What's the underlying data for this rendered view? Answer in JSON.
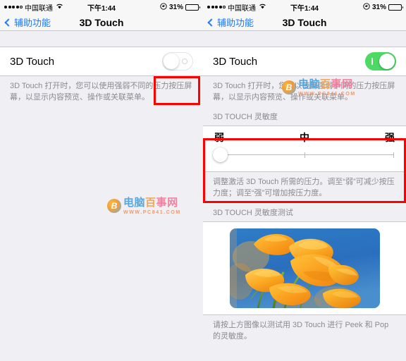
{
  "status_bar": {
    "carrier": "中国联通",
    "signal_dots": 5,
    "signal_filled": 4,
    "wifi_icon": "wifi-icon",
    "time": "下午1:44",
    "rotation_lock_icon": "rotation-lock-icon",
    "battery_percent": "31%",
    "battery_level": 31
  },
  "nav": {
    "back_label": "辅助功能",
    "back_icon": "chevron-left-icon",
    "title": "3D Touch"
  },
  "left_panel": {
    "row_label": "3D Touch",
    "toggle_state": "off",
    "footnote": "3D Touch 打开时，您可以使用强弱不同的压力按压屏幕，以显示内容预览、操作或关联菜单。"
  },
  "right_panel": {
    "row_label": "3D Touch",
    "toggle_state": "on",
    "footnote": "3D Touch 打开时，您可以使用强弱不同的压力按压屏幕，以显示内容预览、操作或关联菜单。",
    "sensitivity_header": "3D TOUCH 灵敏度",
    "slider": {
      "min_label": "弱",
      "mid_label": "中",
      "max_label": "强",
      "value": 0,
      "min": 0,
      "max": 2,
      "ticks": 3
    },
    "slider_footnote": "调整激活 3D Touch 所需的压力。调至“弱”可减少按压力度；调至“强”可增加按压力度。",
    "test_header": "3D TOUCH 灵敏度测试",
    "test_image_alt": "orange-poppy-flowers-photo",
    "test_footnote": "请按上方图像以测试用 3D Touch 进行 Peek 和 Pop 的灵敏度。"
  },
  "watermark": {
    "brand": "电脑百事网",
    "url": "WWW.PC841.COM",
    "logo_icon": "pc841-logo-icon"
  },
  "annotations": {
    "toggle_highlight": "red-box-toggle",
    "slider_highlight": "red-box-sensitivity"
  },
  "colors": {
    "toggle_on": "#4CD964",
    "accent_blue": "#1B7AFF",
    "annotation_red": "#FF0000",
    "group_bg": "#EFEFF4"
  }
}
